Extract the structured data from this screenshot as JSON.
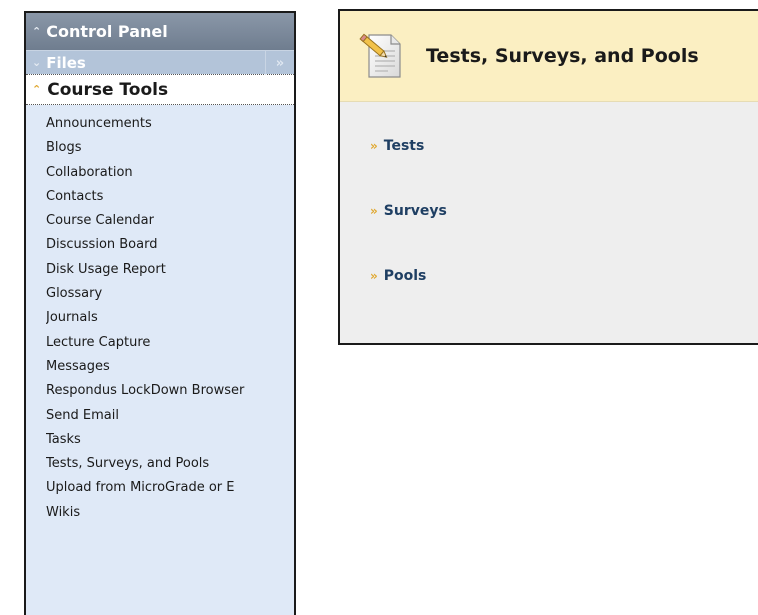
{
  "control_panel": {
    "title": "Control Panel",
    "files_label": "Files",
    "course_tools_label": "Course Tools",
    "course_tools": [
      "Announcements",
      "Blogs",
      "Collaboration",
      "Contacts",
      "Course Calendar",
      "Discussion Board",
      "Disk Usage Report",
      "Glossary",
      "Journals",
      "Lecture Capture",
      "Messages",
      "Respondus LockDown Browser",
      "Send Email",
      "Tasks",
      "Tests, Surveys, and Pools",
      "Upload from MicroGrade or E",
      "Wikis"
    ]
  },
  "tests_panel": {
    "title": "Tests, Surveys, and Pools",
    "links": [
      "Tests",
      "Surveys",
      "Pools"
    ]
  },
  "icons": {
    "collapse": "chevron-up-icon",
    "expand_down": "chevron-down-icon",
    "expand_right": "double-chevron-right-icon",
    "page": "document-pencil-icon"
  },
  "colors": {
    "header_bg": "#7a8798",
    "files_bg": "#b3c4d9",
    "menu_bg": "#dfe9f7",
    "panel_header_bg": "#fbefc2",
    "link_color": "#1f3f63",
    "chevron_color": "#e0a830"
  }
}
